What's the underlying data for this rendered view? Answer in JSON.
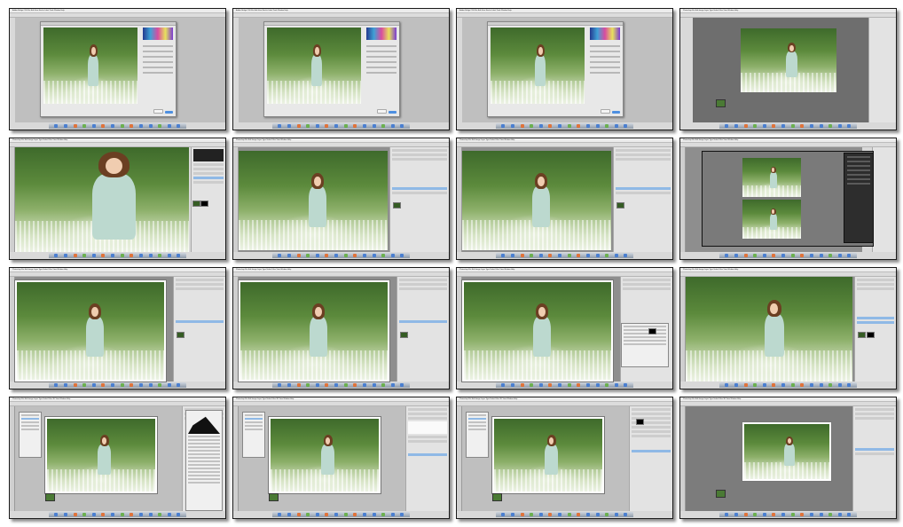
{
  "sheet": {
    "columns": 4,
    "rows": 4,
    "thumbs": [
      {
        "id": "t1",
        "kind": "camera-raw-dialog",
        "menubar": "Adobe Bridge CS6  File  Edit  View  Stacks  Label  Tools  Window  Help"
      },
      {
        "id": "t2",
        "kind": "camera-raw-dialog",
        "menubar": "Adobe Bridge CS6  File  Edit  View  Stacks  Label  Tools  Window  Help"
      },
      {
        "id": "t3",
        "kind": "camera-raw-dialog",
        "menubar": "Adobe Bridge CS6  File  Edit  View  Stacks  Label  Tools  Window  Help"
      },
      {
        "id": "t4",
        "kind": "photo-preview",
        "menubar": "Photoshop  File  Edit  Image  Layer  Type  Select  Filter  View  Window  Help"
      },
      {
        "id": "t5",
        "kind": "photoshop-zoomed",
        "menubar": "Photoshop  File  Edit  Image  Layer  Type  Select  Filter  View  Window  Help"
      },
      {
        "id": "t6",
        "kind": "photoshop-canvas",
        "menubar": "Photoshop  File  Edit  Image  Layer  Type  Select  Filter  View  Window  Help"
      },
      {
        "id": "t7",
        "kind": "photoshop-canvas",
        "menubar": "Photoshop  File  Edit  Image  Layer  Type  Select  Filter  View  Window  Help"
      },
      {
        "id": "t8",
        "kind": "plugin-before-after",
        "menubar": "Photoshop  File  Edit  Image  Layer  Type  Select  Filter  View  Window  Help"
      },
      {
        "id": "t9",
        "kind": "photoshop-canvas",
        "menubar": "Photoshop  File  Edit  Image  Layer  Type  Select  Filter  View  Window  Help"
      },
      {
        "id": "t10",
        "kind": "photoshop-canvas",
        "menubar": "Photoshop  File  Edit  Image  Layer  Type  Select  Filter  View  Window  Help"
      },
      {
        "id": "t11",
        "kind": "photoshop-canvas-dialog",
        "menubar": "Photoshop  File  Edit  Image  Layer  Type  Select  Filter  View  Window  Help"
      },
      {
        "id": "t12",
        "kind": "photoshop-canvas",
        "menubar": "Photoshop  File  Edit  Image  Layer  Type  Select  Filter  View  Window  Help"
      },
      {
        "id": "t13",
        "kind": "photoshop-levels",
        "menubar": "Photoshop  File  Edit  Image  Layer  Type  Select  Filter  3D  View  Window  Help"
      },
      {
        "id": "t14",
        "kind": "photoshop-curves",
        "menubar": "Photoshop  File  Edit  Image  Layer  Type  Select  Filter  3D  View  Window  Help"
      },
      {
        "id": "t15",
        "kind": "photoshop-adjust",
        "menubar": "Photoshop  File  Edit  Image  Layer  Type  Select  Filter  3D  View  Window  Help"
      },
      {
        "id": "t16",
        "kind": "photoshop-frame",
        "menubar": "Photoshop  File  Edit  Image  Layer  Type  Select  Filter  3D  View  Window  Help"
      }
    ]
  },
  "colors": {
    "workspace_gray": "#8e8e8e",
    "panel_gray": "#e3e3e3",
    "selection_blue": "#8fb9e6",
    "grass_green": "#5c8a3c",
    "dress_mint": "#bcd9cf",
    "ok_button_blue": "#4d8fe0"
  },
  "icons": [
    "apple-dock-icon",
    "histogram-icon",
    "layer-thumbnail-icon"
  ]
}
